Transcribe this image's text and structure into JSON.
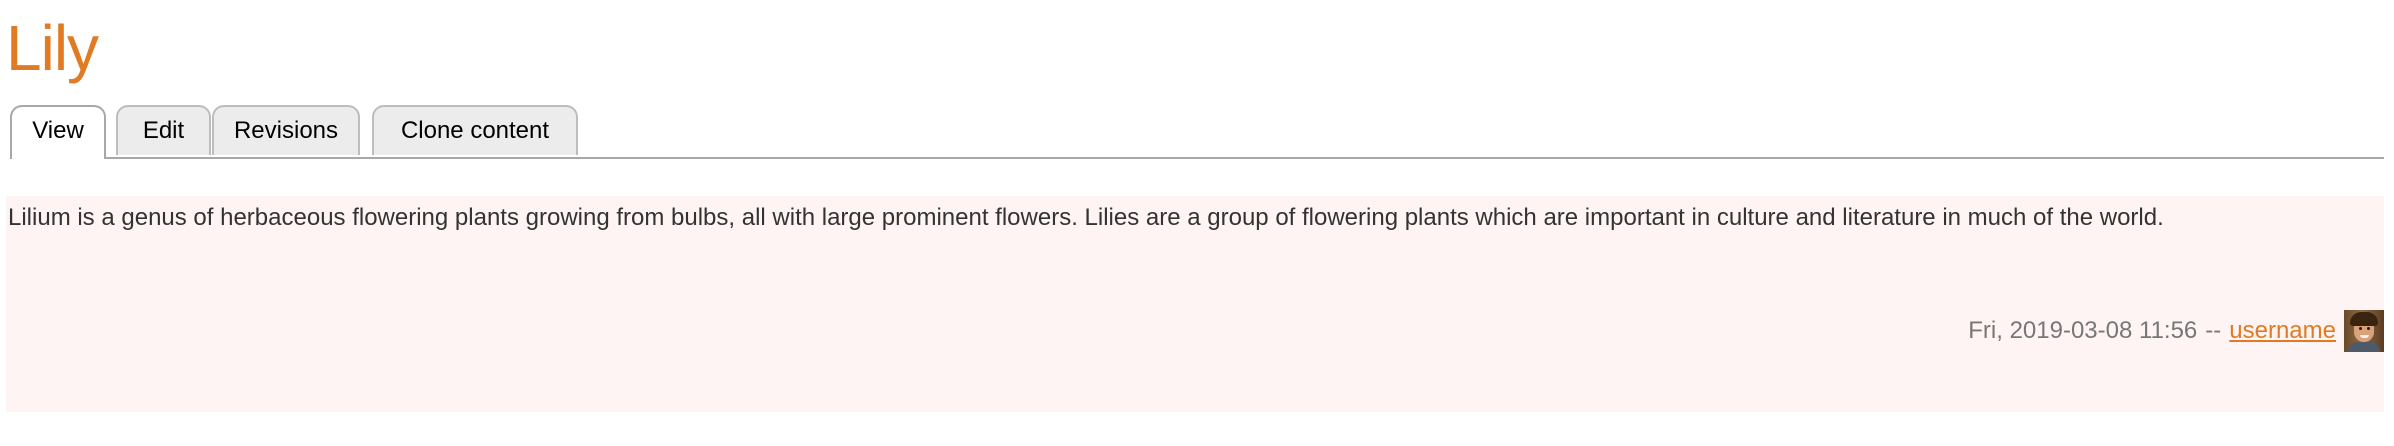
{
  "page": {
    "title": "Lily"
  },
  "tabs": [
    {
      "label": "View",
      "active": true
    },
    {
      "label": "Edit",
      "active": false
    },
    {
      "label": "Revisions",
      "active": false
    },
    {
      "label": "Clone content",
      "active": false
    }
  ],
  "node": {
    "body": "Lilium is a genus of herbaceous flowering plants growing from bulbs, all with large prominent flowers. Lilies are a group of flowering plants which are important in culture and literature in much of the world.",
    "submitted_date": "Fri, 2019-03-08 11:56",
    "separator": "--",
    "author": "username",
    "avatar_icon": "user-avatar-photo"
  },
  "colors": {
    "accent": "#e07b24",
    "node_background": "#fff4f4",
    "tab_inactive": "#ececec"
  }
}
